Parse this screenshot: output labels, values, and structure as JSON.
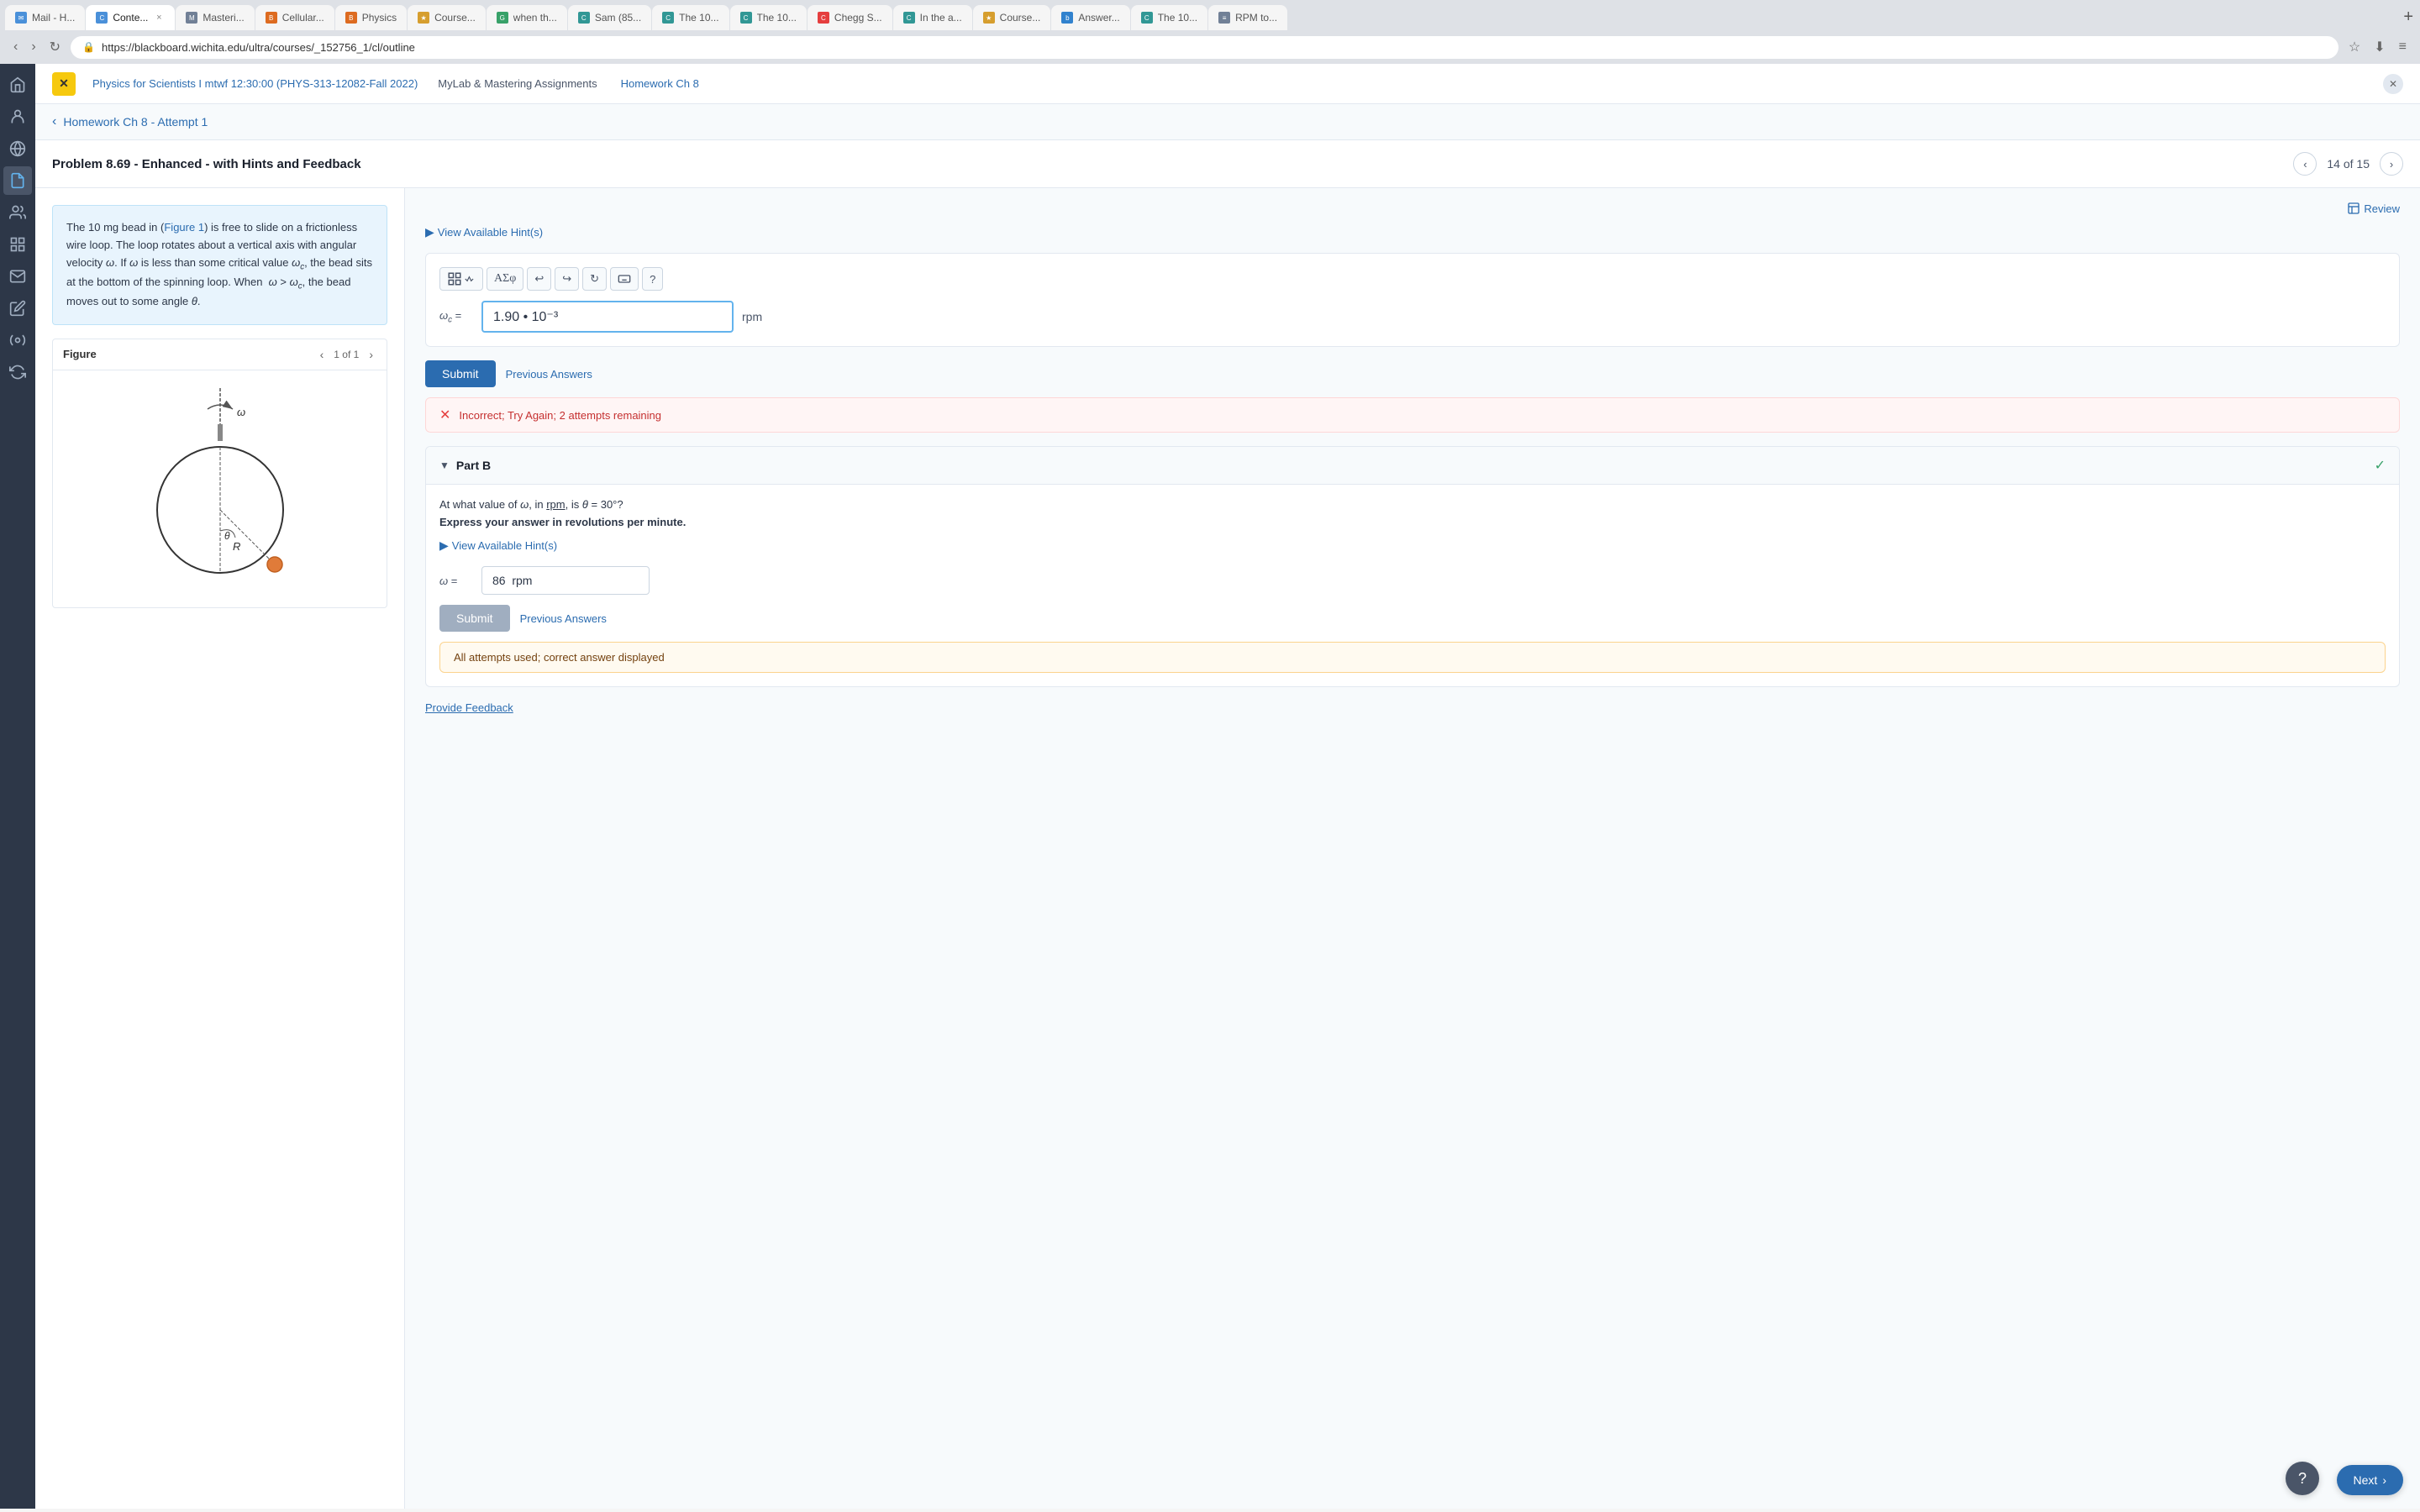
{
  "browser": {
    "url": "https://blackboard.wichita.edu/ultra/courses/_152756_1/cl/outline",
    "tabs": [
      {
        "id": "mail",
        "label": "Mail - H...",
        "favicon_type": "fav-blue",
        "favicon_char": "✉",
        "active": false,
        "closeable": false
      },
      {
        "id": "content",
        "label": "Conte...",
        "favicon_type": "fav-blue",
        "favicon_char": "C",
        "active": true,
        "closeable": true
      },
      {
        "id": "mastering",
        "label": "Masteri...",
        "favicon_type": "fav-gray",
        "favicon_char": "M",
        "active": false,
        "closeable": false
      },
      {
        "id": "cellular",
        "label": "Cellular...",
        "favicon_type": "fav-orange",
        "favicon_char": "Bb",
        "active": false,
        "closeable": false
      },
      {
        "id": "physics2",
        "label": "Physics",
        "favicon_type": "fav-orange",
        "favicon_char": "Bb",
        "active": false,
        "closeable": false
      },
      {
        "id": "course",
        "label": "Course...",
        "favicon_type": "fav-yellow",
        "favicon_char": "★",
        "active": false,
        "closeable": false
      },
      {
        "id": "when",
        "label": "when th...",
        "favicon_type": "fav-green",
        "favicon_char": "G",
        "active": false,
        "closeable": false
      },
      {
        "id": "sam",
        "label": "Sam (85...",
        "favicon_type": "fav-teal",
        "favicon_char": "C",
        "active": false,
        "closeable": false
      },
      {
        "id": "the10a",
        "label": "The 10...",
        "favicon_type": "fav-teal",
        "favicon_char": "C",
        "active": false,
        "closeable": false
      },
      {
        "id": "the10b",
        "label": "The 10...",
        "favicon_type": "fav-teal",
        "favicon_char": "C",
        "active": false,
        "closeable": false
      },
      {
        "id": "chegg",
        "label": "Chegg S...",
        "favicon_type": "fav-red",
        "favicon_char": "C",
        "active": false,
        "closeable": false
      },
      {
        "id": "inthe",
        "label": "In the a...",
        "favicon_type": "fav-teal",
        "favicon_char": "C",
        "active": false,
        "closeable": false
      },
      {
        "id": "course2",
        "label": "Course...",
        "favicon_type": "fav-yellow",
        "favicon_char": "★",
        "active": false,
        "closeable": false
      },
      {
        "id": "answers",
        "label": "Answer...",
        "favicon_type": "fav-blue",
        "favicon_char": "b",
        "active": false,
        "closeable": false
      },
      {
        "id": "the10c",
        "label": "The 10...",
        "favicon_type": "fav-teal",
        "favicon_char": "C",
        "active": false,
        "closeable": false
      },
      {
        "id": "rpm",
        "label": "RPM to...",
        "favicon_type": "fav-gray",
        "favicon_char": "≡",
        "active": false,
        "closeable": false
      }
    ]
  },
  "course": {
    "title": "Physics for Scientists I mtwf 12:30:00 (PHYS-313-12082-Fall 2022)",
    "nav_links": [
      {
        "id": "mylab",
        "label": "MyLab & Mastering Assignments"
      },
      {
        "id": "homework",
        "label": "Homework Ch 8"
      }
    ]
  },
  "attempt": {
    "back_label": "Homework Ch 8 - Attempt 1"
  },
  "problem": {
    "title": "Problem 8.69 - Enhanced - with Hints and Feedback",
    "current": "14",
    "total": "15",
    "counter_label": "14 of 15"
  },
  "problem_text": {
    "content": "The 10 mg bead in (Figure 1) is free to slide on a frictionless wire loop. The loop rotates about a vertical axis with angular velocity ω. If ω is less than some critical value ω_c, the bead sits at the bottom of the spinning loop. When ω > ω_c, the bead moves out to some angle θ.",
    "figure_ref": "Figure 1"
  },
  "figure": {
    "title": "Figure",
    "nav_label": "1 of 1"
  },
  "part_a": {
    "hint_label": "View Available Hint(s)",
    "answer_label": "ω_c =",
    "answer_value": "1.90 • 10⁻³",
    "answer_unit": "rpm",
    "submit_label": "Submit",
    "prev_answers_label": "Previous Answers",
    "incorrect_text": "Incorrect; Try Again; 2 attempts remaining"
  },
  "part_b": {
    "title": "Part B",
    "question": "At what value of ω, in rpm, is θ = 30°?",
    "instruction": "Express your answer in revolutions per minute.",
    "hint_label": "View Available Hint(s)",
    "answer_label": "ω =",
    "answer_value": "86  rpm",
    "submit_label": "Submit",
    "prev_answers_label": "Previous Answers",
    "all_attempts_text": "All attempts used; correct answer displayed"
  },
  "footer": {
    "feedback_label": "Provide Feedback",
    "next_label": "Next"
  },
  "review_label": "Review",
  "math_toolbar": {
    "buttons": [
      "matrix-icon",
      "sigma-icon",
      "undo-icon",
      "redo-icon",
      "refresh-icon",
      "keyboard-icon",
      "help-icon"
    ]
  },
  "sidebar_icons": [
    "home",
    "person",
    "globe",
    "document",
    "group",
    "grid",
    "mail",
    "edit",
    "tools",
    "sync"
  ]
}
